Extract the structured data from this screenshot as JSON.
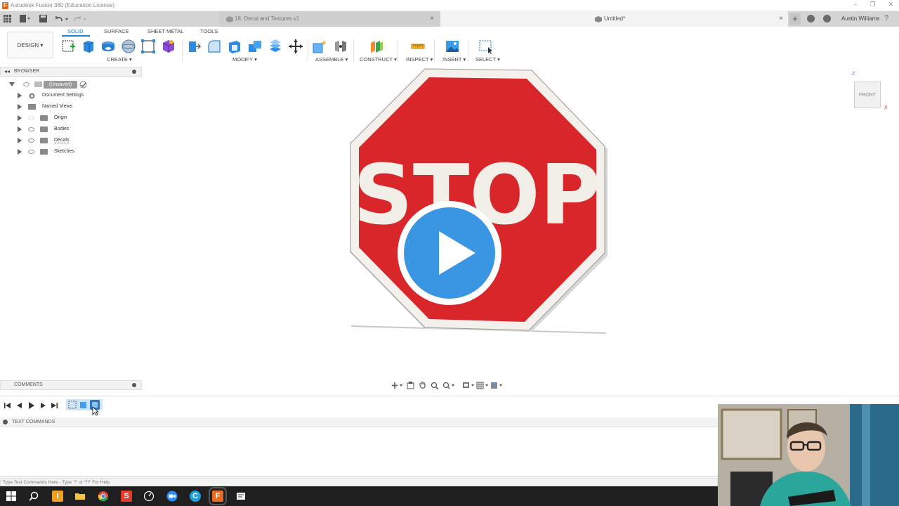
{
  "window": {
    "app_title": "Autodesk Fusion 360 (Education License)",
    "controls": [
      "–",
      "❐",
      "✕"
    ]
  },
  "tabs": [
    {
      "label": "18. Decal and Textures v1",
      "close": "×"
    },
    {
      "label": "Untitled*",
      "close": "×"
    }
  ],
  "header": {
    "user": "Austin Williams",
    "help": "?",
    "new_tab": "+"
  },
  "toolbar": {
    "workspace": "DESIGN ▾",
    "workspace_tabs": [
      "SOLID",
      "SURFACE",
      "SHEET METAL",
      "TOOLS"
    ],
    "groups": [
      "CREATE ▾",
      "MODIFY ▾",
      "ASSEMBLE ▾",
      "CONSTRUCT ▾",
      "INSPECT ▾",
      "INSERT ▾",
      "SELECT ▾"
    ]
  },
  "browser": {
    "title": "BROWSER",
    "root": "(Unsaved)",
    "items": [
      "Document Settings",
      "Named Views",
      "Origin",
      "Bodies",
      "Decals",
      "Sketches"
    ]
  },
  "viewcube": {
    "face": "FRONT",
    "axis_z": "Z",
    "axis_x": "X"
  },
  "model": {
    "sign_text": "STOP",
    "sign_color": "#d9262a",
    "text_color": "#f2efe9"
  },
  "comments": {
    "title": "COMMENTS"
  },
  "text_commands": {
    "title": "TEXT COMMANDS",
    "placeholder": "Type Text Commands Here - Type '?' or '??' For Help"
  },
  "colors": {
    "accent": "#1a7fd6",
    "play": "#3a95e2",
    "taskbar": "#1f1f1f"
  }
}
